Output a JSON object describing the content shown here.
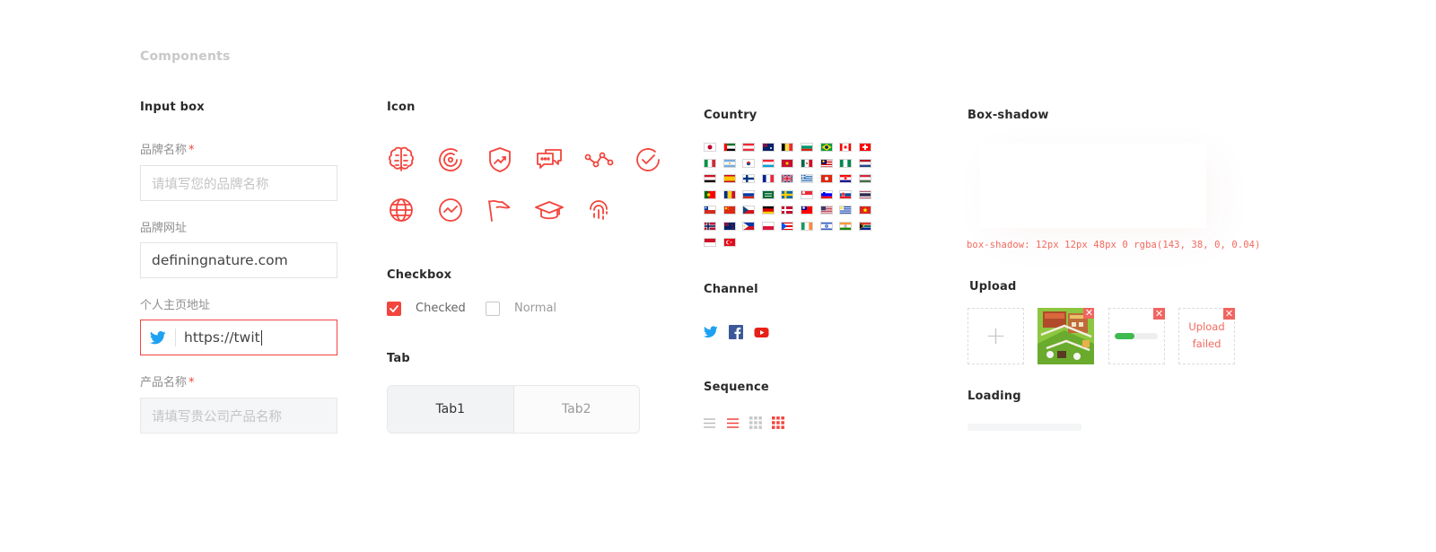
{
  "page_title": "Components",
  "input_box": {
    "title": "Input box",
    "brand_name": {
      "label": "品牌名称",
      "required_mark": "*",
      "placeholder": "请填写您的品牌名称"
    },
    "brand_url": {
      "label": "品牌网址",
      "value": "definingnature.com"
    },
    "homepage": {
      "label": "个人主页地址",
      "value": "https://twit",
      "icon": "twitter-icon"
    },
    "product_name": {
      "label": "产品名称",
      "required_mark": "*",
      "placeholder": "请填写贵公司产品名称"
    }
  },
  "icon_section": {
    "title": "Icon",
    "icons": [
      "brain-icon",
      "target-icon",
      "shield-trend-icon",
      "chat-bubbles-icon",
      "nodes-icon",
      "check-circle-icon",
      "globe-icon",
      "trend-circle-icon",
      "flag-icon",
      "graduation-cap-icon",
      "fingerprint-icon"
    ]
  },
  "checkbox_section": {
    "title": "Checkbox",
    "checked_label": "Checked",
    "normal_label": "Normal"
  },
  "tab_section": {
    "title": "Tab",
    "tabs": [
      "Tab1",
      "Tab2"
    ],
    "active_index": 0
  },
  "country_section": {
    "title": "Country",
    "flags": [
      "jp",
      "ae",
      "at",
      "au",
      "be",
      "bg",
      "br",
      "ca",
      "ch",
      "it",
      "ar",
      "kr",
      "lu",
      "mo",
      "mx",
      "my",
      "ng",
      "nl",
      "eg",
      "es",
      "fi",
      "fr",
      "gb",
      "gr",
      "hk",
      "hr",
      "hu",
      "pt",
      "ro",
      "ru",
      "sa",
      "se",
      "sg",
      "si",
      "sk",
      "th",
      "cl",
      "cn",
      "cz",
      "de",
      "dk",
      "tw",
      "us",
      "uy",
      "vn",
      "no",
      "nz",
      "ph",
      "pl",
      "pr",
      "ie",
      "il",
      "in",
      "za",
      "id",
      "tr"
    ]
  },
  "channel_section": {
    "title": "Channel",
    "channels": [
      "twitter-icon",
      "facebook-icon",
      "youtube-icon"
    ]
  },
  "sequence_section": {
    "title": "Sequence",
    "views": [
      "list-view-icon",
      "list-view-active-icon",
      "grid-view-icon",
      "grid-view-active-icon"
    ]
  },
  "box_shadow_section": {
    "title": "Box-shadow",
    "caption": "box-shadow: 12px 12px 48px 0 rgba(143, 38, 0, 0.04)"
  },
  "upload_section": {
    "title": "Upload",
    "add_symbol": "+",
    "progress": 0.45,
    "failed_label_1": "Upload",
    "failed_label_2": "failed",
    "remove_symbol": "✕"
  },
  "loading_section": {
    "title": "Loading"
  },
  "colors": {
    "accent": "#f2453d",
    "twitter": "#1da1f2",
    "facebook": "#3b5998",
    "youtube": "#e62117",
    "progress": "#3dbb4f"
  }
}
